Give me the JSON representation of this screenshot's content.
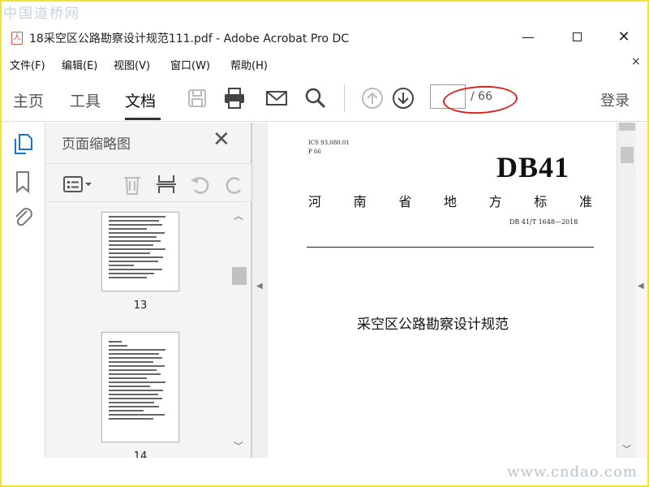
{
  "watermarks": {
    "top_left": "中国道桥网",
    "bottom_right": "www.cndao.com"
  },
  "window": {
    "title": "18采空区公路勘察设计规范111.pdf - Adobe Acrobat Pro DC",
    "minimize": "—",
    "close": "✕"
  },
  "menu": {
    "items": [
      "文件(F)",
      "编辑(E)",
      "视图(V)",
      "窗口(W)",
      "帮助(H)"
    ],
    "close": "×"
  },
  "toolbar": {
    "tabs": [
      "主页",
      "工具",
      "文档"
    ],
    "active_tab": "文档",
    "page_current": "",
    "page_total": "/ 66",
    "login": "登录",
    "icons": [
      "save-icon",
      "print-icon",
      "mail-icon",
      "search-icon",
      "arrow-up-circle-icon",
      "arrow-down-circle-icon"
    ]
  },
  "sidebar": {
    "icons": [
      "page-thumbnails-icon",
      "bookmark-icon",
      "attachment-icon"
    ]
  },
  "thumbnails": {
    "title": "页面缩略图",
    "pages": [
      {
        "label": "13"
      },
      {
        "label": "14"
      }
    ]
  },
  "document": {
    "ics": "ICS 93.080.01",
    "p": "P 66",
    "code": "DB41",
    "standard_chars": [
      "河",
      "南",
      "省",
      "地",
      "方",
      "标",
      "准"
    ],
    "number": "DB 41/T 1648—2018",
    "title": "采空区公路勘察设计规范"
  },
  "colors": {
    "frame": "#f2e33a",
    "annotation": "#d9251d"
  }
}
